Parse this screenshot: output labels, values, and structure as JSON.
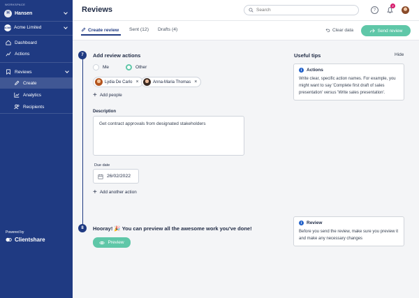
{
  "sidebar": {
    "workspace_label": "WORKSPACE",
    "workspace_initial": "H",
    "workspace_name": "Hansen",
    "client_logo_text": "ACME",
    "client_name": "Acme Limited",
    "items": [
      {
        "label": "Dashboard",
        "icon": "home-icon"
      },
      {
        "label": "Actions",
        "icon": "trend-icon"
      },
      {
        "label": "Reviews",
        "icon": "bookmark-icon"
      },
      {
        "label": "Create",
        "icon": "pencil-icon",
        "active": true
      },
      {
        "label": "Analytics",
        "icon": "chart-icon"
      },
      {
        "label": "Recipients",
        "icon": "users-icon"
      }
    ],
    "powered_by": "Powered by",
    "brand": "Clientshare"
  },
  "header": {
    "title": "Reviews",
    "search_placeholder": "Search",
    "help_glyph": "?",
    "notification_count": "2"
  },
  "tabs": {
    "create": "Create review",
    "sent": "Sent (12)",
    "drafts": "Drafts (4)"
  },
  "toolbar": {
    "clear": "Clear data",
    "send": "Send review"
  },
  "form": {
    "step1_number": "7",
    "step1_title": "Add review actions",
    "radio_me": "Me",
    "radio_other": "Other",
    "selected_radio": "Other",
    "people": [
      "Lydia De Carlo",
      "Anna-Maria Thomas"
    ],
    "remove_glyph": "×",
    "add_people": "Add people",
    "description_label": "Description",
    "description_value": "Get contract approvals from designated stakeholders",
    "due_label": "Due date",
    "due_value": "26/02/2022",
    "add_action": "Add another action",
    "add_glyph": "+",
    "step2_number": "8",
    "step2_title": "Hooray! 🎉 You can preview all the awesome work you've done!",
    "preview": "Preview"
  },
  "tips": {
    "title": "Useful tips",
    "hide": "Hide",
    "info_glyph": "i",
    "card1_title": "Actions",
    "card1_body": "Write clear, specific action names. For example, you might want to say 'Complete first draft of sales presentation' versus 'Write sales presentation'.",
    "card2_title": "Review",
    "card2_body": "Before you send the review, make sure you preview it and make any necessary changes"
  },
  "colors": {
    "sidebar": "#1f3a82",
    "accent": "#5fc7a8",
    "badge": "#d6196b",
    "info": "#2563c9"
  }
}
